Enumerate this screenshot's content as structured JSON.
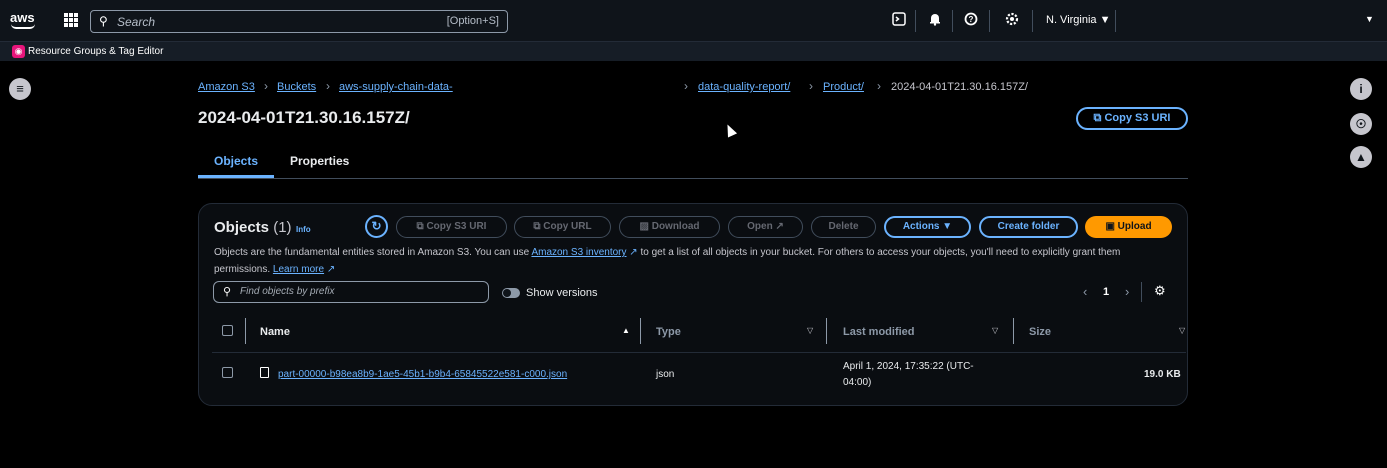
{
  "topbar": {
    "logo_text": "aws",
    "search_placeholder": "Search",
    "search_shortcut": "[Option+S]",
    "icons": [
      "cloudshell-icon",
      "bell-icon",
      "help-icon",
      "gear-icon"
    ],
    "region": "N. Virginia ▼",
    "account_caret": "▼"
  },
  "favorites": {
    "item_label": "Resource Groups & Tag Editor"
  },
  "breadcrumbs": {
    "items": [
      "Amazon S3",
      "Buckets",
      "aws-supply-chain-data-",
      "data-quality-report/",
      "Product/"
    ],
    "current": "2024-04-01T21.30.16.157Z/"
  },
  "page": {
    "title": "2024-04-01T21.30.16.157Z/",
    "copy_uri_label": "Copy S3 URI"
  },
  "tabs": [
    "Objects",
    "Properties"
  ],
  "objects_panel": {
    "title": "Objects",
    "count": "(1)",
    "info": "Info",
    "buttons": {
      "copy_s3_uri": "Copy S3 URI",
      "copy_url": "Copy URL",
      "download": "Download",
      "open": "Open",
      "delete": "Delete",
      "actions": "Actions ▼",
      "create_folder": "Create folder",
      "upload": "Upload"
    },
    "description_1": "Objects are the fundamental entities stored in Amazon S3. You can use",
    "description_link": "Amazon S3 inventory",
    "description_2": "to get a list of all objects in your bucket. For others to access your objects, you'll need to explicitly grant them permissions.",
    "learn_more": "Learn more",
    "filter_placeholder": "Find objects by prefix",
    "show_versions": "Show versions",
    "page_number": "1"
  },
  "table": {
    "columns": [
      "Name",
      "Type",
      "Last modified",
      "Size"
    ],
    "rows": [
      {
        "name": "part-00000-b98ea8b9-1ae5-45b1-b9b4-65845522e581-c000.json",
        "type": "json",
        "last_modified_1": "April 1, 2024, 17:35:22 (UTC-",
        "last_modified_2": "04:00)",
        "size": "19.0 KB"
      }
    ]
  },
  "colors": {
    "link": "#6bb3ff",
    "primary": "#ff9900",
    "background": "#000000"
  }
}
